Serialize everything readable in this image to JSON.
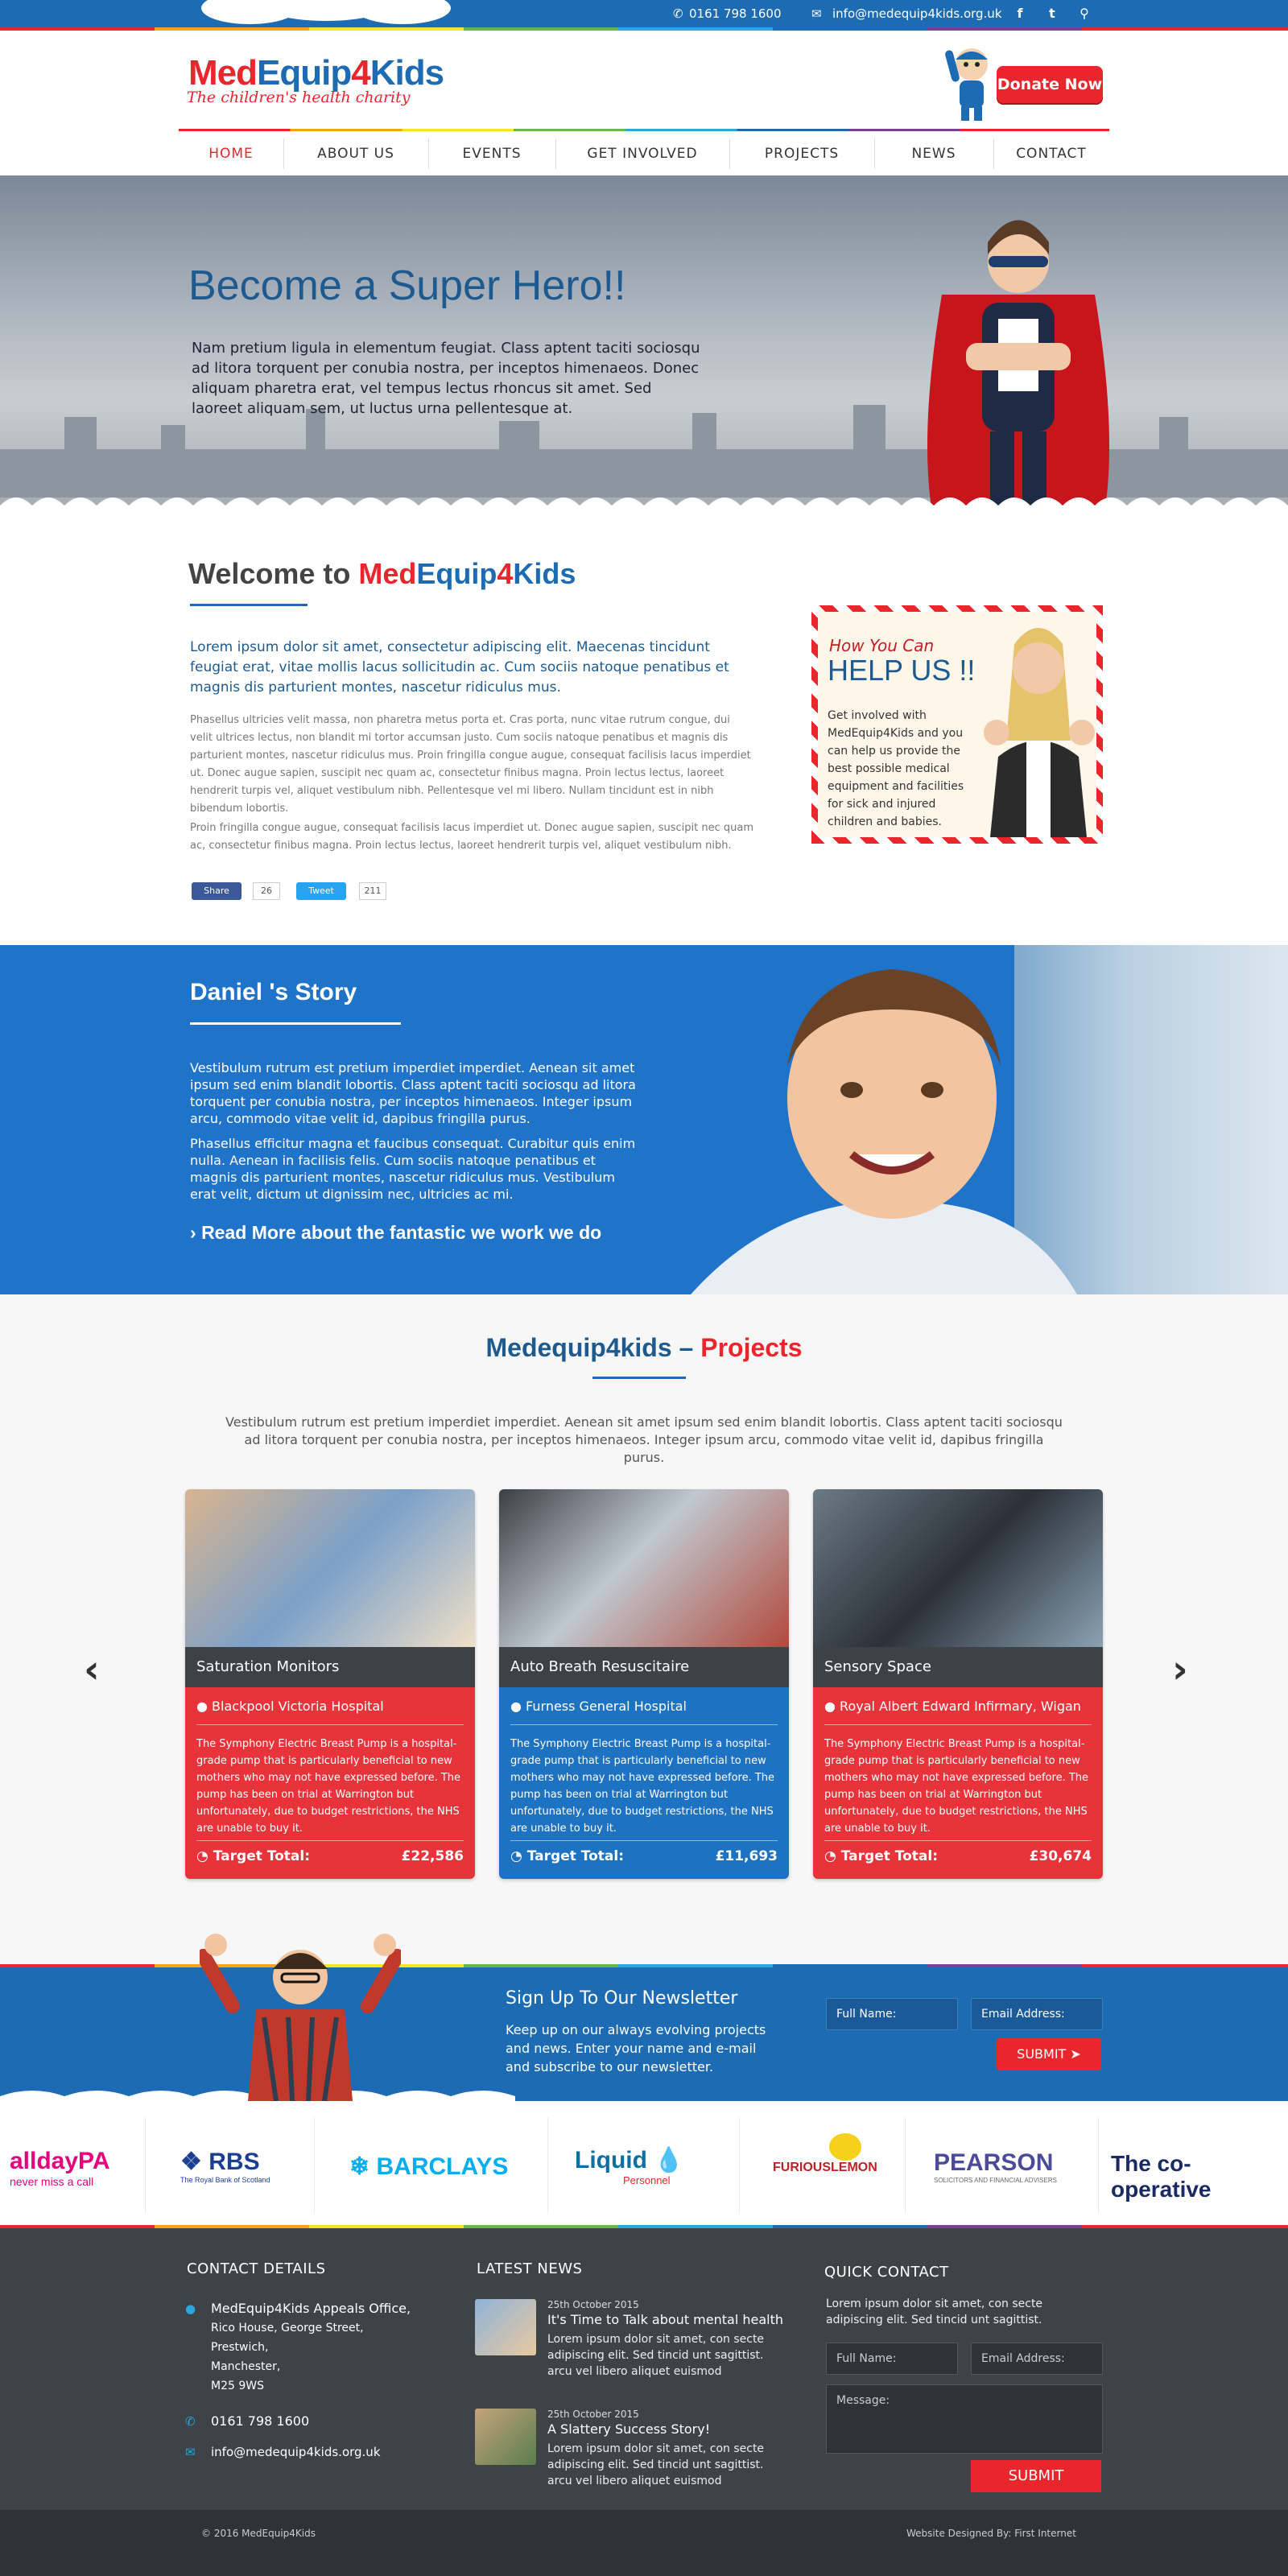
{
  "topbar": {
    "phone": "0161 798 1600",
    "email": "info@medequip4kids.org.uk"
  },
  "header": {
    "logo_med": "Med",
    "logo_equip": "Equip",
    "logo_4": "4",
    "logo_kids": "Kids",
    "tagline": "The children's health charity",
    "donate": "Donate Now"
  },
  "nav": [
    "HOME",
    "ABOUT US",
    "EVENTS",
    "GET INVOLVED",
    "PROJECTS",
    "NEWS",
    "CONTACT"
  ],
  "hero": {
    "title": "Become a Super Hero!!",
    "text": "Nam pretium ligula in elementum feugiat. Class aptent taciti sociosqu ad litora torquent per conubia nostra, per inceptos himenaeos. Donec aliquam pharetra erat, vel tempus lectus rhoncus sit amet. Sed laoreet aliquam sem, ut luctus urna pellentesque at."
  },
  "welcome": {
    "title_pre": "Welcome to ",
    "title_med": "Med",
    "title_equip": "Equip",
    "title_4": "4",
    "title_kids": "Kids",
    "lead": "Lorem ipsum dolor sit amet, consectetur adipiscing elit. Maecenas tincidunt feugiat erat, vitae mollis lacus sollicitudin ac. Cum sociis natoque penatibus et magnis dis parturient montes, nascetur ridiculus mus.",
    "p1": "Phasellus ultricies velit massa, non pharetra metus porta et. Cras porta, nunc vitae rutrum congue, dui velit ultrices lectus, non blandit mi tortor accumsan justo. Cum sociis natoque penatibus et magnis dis parturient montes, nascetur ridiculus mus. Proin fringilla congue augue, consequat facilisis lacus imperdiet ut. Donec augue sapien, suscipit nec quam ac, consectetur finibus magna. Proin lectus lectus, laoreet hendrerit turpis vel, aliquet vestibulum nibh. Pellentesque vel mi libero. Nullam tincidunt est in nibh bibendum lobortis.",
    "p2": "Proin fringilla congue augue, consequat facilisis lacus imperdiet ut. Donec augue sapien, suscipit nec quam ac, consectetur finibus magna. Proin lectus lectus, laoreet hendrerit turpis vel, aliquet vestibulum nibh.",
    "share": "Share",
    "share_count": "26",
    "tweet": "Tweet",
    "tweet_count": "211"
  },
  "help": {
    "pre": "How You Can",
    "main": "HELP US !!",
    "text": "Get involved with MedEquip4Kids and you can help us provide the best possible medical equipment and facilities for sick and injured children and babies."
  },
  "daniel": {
    "title": "Daniel 's Story",
    "p1": "Vestibulum rutrum est pretium imperdiet imperdiet. Aenean sit amet ipsum sed enim blandit lobortis. Class aptent taciti sociosqu ad litora torquent per conubia nostra, per inceptos himenaeos. Integer ipsum arcu, commodo vitae velit id, dapibus fringilla purus.",
    "p2": "Phasellus efficitur magna et faucibus consequat. Curabitur quis enim nulla. Aenean in facilisis felis. Cum sociis natoque penatibus et magnis dis parturient montes, nascetur ridiculus mus. Vestibulum erat velit, dictum ut dignissim nec, ultricies ac mi.",
    "link": "Read More about the fantastic we work we do"
  },
  "projects": {
    "title_a": "Medequip4kids – ",
    "title_b": "Projects",
    "intro": "Vestibulum rutrum est pretium imperdiet imperdiet. Aenean sit amet ipsum sed enim blandit lobortis. Class aptent taciti sociosqu ad litora torquent per conubia nostra, per inceptos himenaeos. Integer ipsum arcu, commodo vitae velit id, dapibus fringilla purus.",
    "cards": [
      {
        "name": "Saturation Monitors",
        "location": "Blackpool Victoria Hospital",
        "desc": "The Symphony Electric Breast Pump is a hospital-grade pump that is particularly beneficial to new mothers who may not have expressed before. The pump has been on trial at Warrington but unfortunately, due to budget restrictions, the NHS are unable to buy it.",
        "target": "Target Total:",
        "amount": "£22,586",
        "color": "#e8333a"
      },
      {
        "name": "Auto Breath Resuscitaire",
        "location": "Furness General Hospital",
        "desc": "The Symphony Electric Breast Pump is a hospital-grade pump that is particularly beneficial to new mothers who may not have expressed before. The pump has been on trial at Warrington but unfortunately, due to budget restrictions, the NHS are unable to buy it.",
        "target": "Target Total:",
        "amount": "£11,693",
        "color": "#1d72c2"
      },
      {
        "name": "Sensory Space",
        "location": "Royal Albert Edward Infirmary, Wigan",
        "desc": "The Symphony Electric Breast Pump is a hospital-grade pump that is particularly beneficial to new mothers who may not have expressed before. The pump has been on trial at Warrington but unfortunately, due to budget restrictions, the NHS are unable to buy it.",
        "target": "Target Total:",
        "amount": "£30,674",
        "color": "#e8333a"
      }
    ]
  },
  "newsletter": {
    "title": "Sign Up To Our Newsletter",
    "text": "Keep up on our always evolving projects and news. Enter your name and e-mail and subscribe to our newsletter.",
    "name_placeholder": "Full Name:",
    "email_placeholder": "Email Address:",
    "submit": "SUBMIT"
  },
  "partners": {
    "allday": "alldayPA",
    "allday_sub": "never miss a call",
    "rbs": "RBS",
    "rbs_sub": "The Royal Bank of Scotland",
    "barclays": "BARCLAYS",
    "liquid": "Liquid",
    "liquid_sub": "Personnel",
    "furious": "FURIOUSLEMON",
    "pearson": "PEARSON",
    "pearson_sub": "SOLICITORS AND FINANCIAL ADVISERS",
    "coop": "The co-operative"
  },
  "footer": {
    "contact_title": "CONTACT DETAILS",
    "address": [
      "MedEquip4Kids  Appeals Office,",
      "Rico House, George Street,",
      "Prestwich,",
      "Manchester,",
      "M25 9WS"
    ],
    "phone": "0161 798 1600",
    "email": "info@medequip4kids.org.uk",
    "news_title": "LATEST NEWS",
    "news": [
      {
        "date": "25th October 2015",
        "title": "It's Time to Talk about mental health",
        "text": "Lorem ipsum dolor sit amet, con secte adipiscing elit. Sed tincid unt sagittist. arcu vel libero aliquet euismod"
      },
      {
        "date": "25th October 2015",
        "title": "A Slattery Success Story!",
        "text": "Lorem ipsum dolor sit amet, con secte adipiscing elit. Sed tincid unt sagittist. arcu vel libero aliquet euismod"
      }
    ],
    "quick_title": "QUICK CONTACT",
    "quick_text": "Lorem ipsum dolor sit amet, con secte adipiscing elit. Sed tincid unt sagittist.",
    "name_placeholder": "Full Name:",
    "email_placeholder": "Email Address:",
    "message_placeholder": "Message:",
    "submit": "SUBMIT",
    "copyright": "© 2016 MedEquip4Kids",
    "designed": "Website Designed By: First Internet"
  }
}
